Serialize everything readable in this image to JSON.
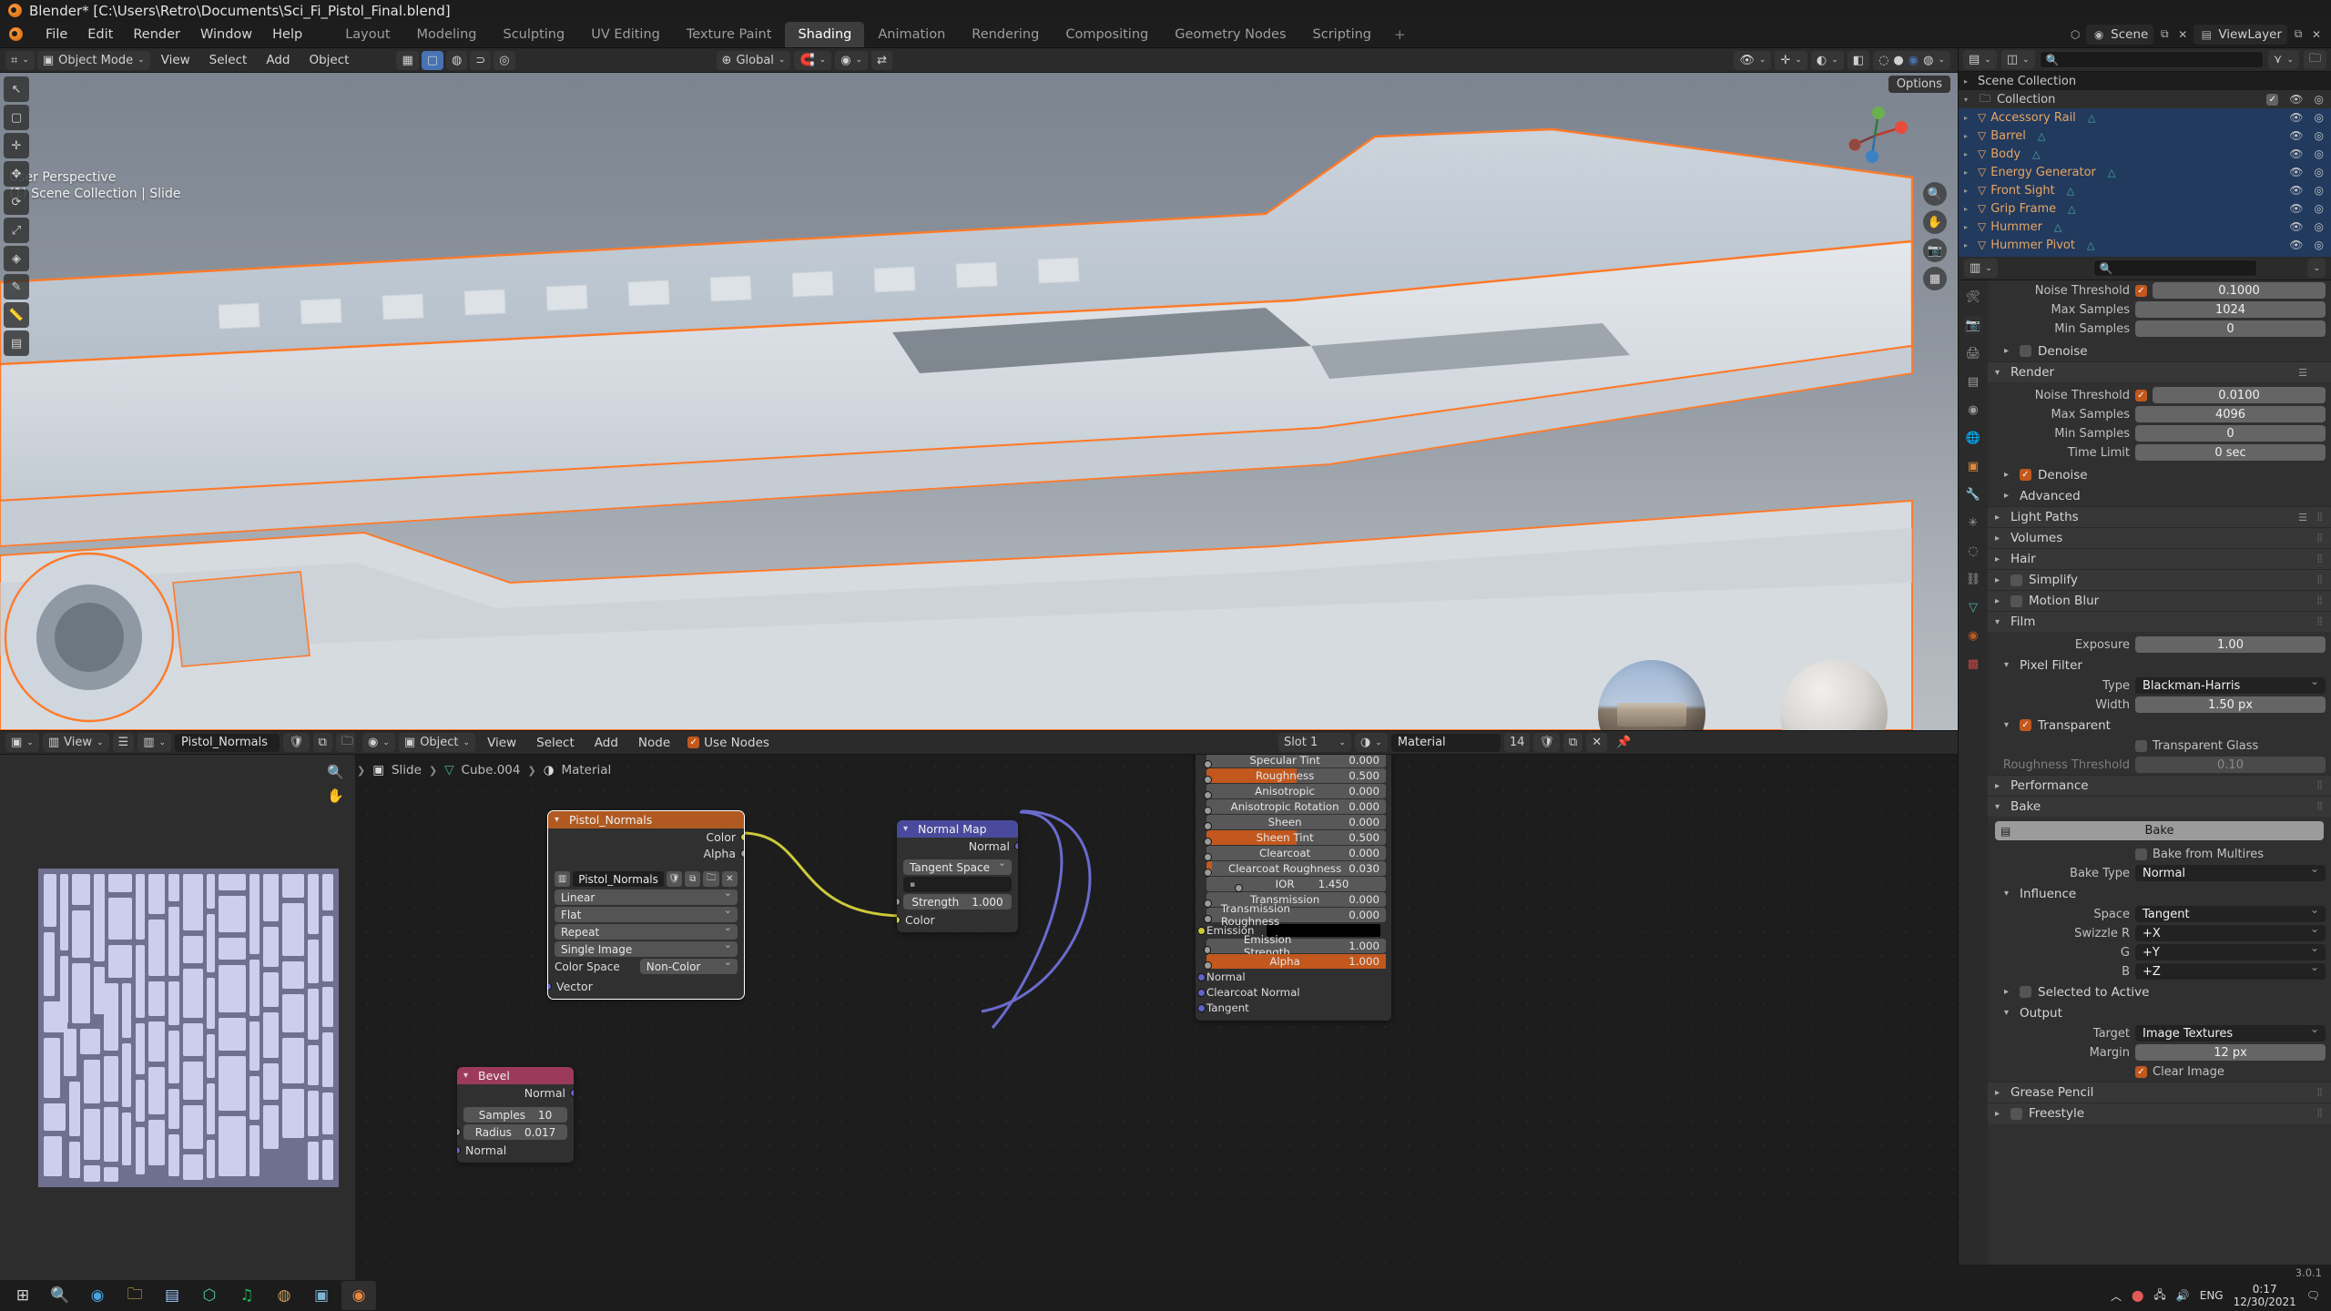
{
  "window": {
    "title": "Blender* [C:\\Users\\Retro\\Documents\\Sci_Fi_Pistol_Final.blend]"
  },
  "topbar": {
    "menus": [
      "File",
      "Edit",
      "Render",
      "Window",
      "Help"
    ],
    "workspace_tabs": [
      {
        "label": "Layout",
        "active": false
      },
      {
        "label": "Modeling",
        "active": false
      },
      {
        "label": "Sculpting",
        "active": false
      },
      {
        "label": "UV Editing",
        "active": false
      },
      {
        "label": "Texture Paint",
        "active": false
      },
      {
        "label": "Shading",
        "active": true
      },
      {
        "label": "Animation",
        "active": false
      },
      {
        "label": "Rendering",
        "active": false
      },
      {
        "label": "Compositing",
        "active": false
      },
      {
        "label": "Geometry Nodes",
        "active": false
      },
      {
        "label": "Scripting",
        "active": false
      }
    ],
    "add_tab": "+",
    "scene_name": "Scene",
    "viewlayer_name": "ViewLayer"
  },
  "viewport": {
    "mode": "Object Mode",
    "menus": [
      "View",
      "Select",
      "Add",
      "Object"
    ],
    "transform_orientation": "Global",
    "options_label": "Options",
    "overlay_line1": "User Perspective",
    "overlay_line2": "(1) Scene Collection | Slide"
  },
  "outliner": {
    "search_placeholder": "",
    "scene_collection": "Scene Collection",
    "collection": "Collection",
    "items": [
      {
        "name": "Accessory Rail"
      },
      {
        "name": "Barrel"
      },
      {
        "name": "Body"
      },
      {
        "name": "Energy Generator"
      },
      {
        "name": "Front Sight"
      },
      {
        "name": "Grip Frame"
      },
      {
        "name": "Hummer"
      },
      {
        "name": "Hummer Pivot"
      }
    ]
  },
  "properties": {
    "sampling_viewport": {
      "noise_threshold_label": "Noise Threshold",
      "noise_threshold_value": "0.1000",
      "max_samples_label": "Max Samples",
      "max_samples_value": "1024",
      "min_samples_label": "Min Samples",
      "min_samples_value": "0",
      "denoise_label": "Denoise"
    },
    "render": {
      "panel_label": "Render",
      "noise_threshold_label": "Noise Threshold",
      "noise_threshold_value": "0.0100",
      "max_samples_label": "Max Samples",
      "max_samples_value": "4096",
      "min_samples_label": "Min Samples",
      "min_samples_value": "0",
      "time_limit_label": "Time Limit",
      "time_limit_value": "0 sec",
      "denoise_label": "Denoise",
      "advanced_label": "Advanced"
    },
    "sections": [
      {
        "label": "Light Paths"
      },
      {
        "label": "Volumes"
      },
      {
        "label": "Hair"
      },
      {
        "label": "Simplify"
      },
      {
        "label": "Motion Blur"
      }
    ],
    "film": {
      "panel_label": "Film",
      "exposure_label": "Exposure",
      "exposure_value": "1.00",
      "pixel_filter_label": "Pixel Filter",
      "type_label": "Type",
      "type_value": "Blackman-Harris",
      "width_label": "Width",
      "width_value": "1.50 px",
      "transparent_label": "Transparent",
      "transparent_glass_label": "Transparent Glass",
      "roughness_threshold_label": "Roughness Threshold",
      "roughness_threshold_value": "0.10"
    },
    "performance_label": "Performance",
    "bake": {
      "panel_label": "Bake",
      "bake_button": "Bake",
      "bake_from_multires_label": "Bake from Multires",
      "bake_type_label": "Bake Type",
      "bake_type_value": "Normal",
      "influence_label": "Influence",
      "space_label": "Space",
      "space_value": "Tangent",
      "swizzle_r_label": "Swizzle R",
      "swizzle_r_value": "+X",
      "swizzle_g_label": "G",
      "swizzle_g_value": "+Y",
      "swizzle_b_label": "B",
      "swizzle_b_value": "+Z",
      "selected_to_active_label": "Selected to Active",
      "output_label": "Output",
      "target_label": "Target",
      "target_value": "Image Textures",
      "margin_label": "Margin",
      "margin_value": "12 px",
      "clear_image_label": "Clear Image"
    },
    "grease_pencil_label": "Grease Pencil",
    "freestyle_label": "Freestyle"
  },
  "image_editor": {
    "view_menu": "View",
    "image_name": "Pistol_Normals"
  },
  "node_editor": {
    "shader_type": "Object",
    "menus": [
      "View",
      "Select",
      "Add",
      "Node"
    ],
    "use_nodes_label": "Use Nodes",
    "slot_label": "Slot 1",
    "material_name": "Material",
    "material_users": "14",
    "breadcrumb": [
      "Slide",
      "Cube.004",
      "Material"
    ],
    "nodes": {
      "image_texture": {
        "title": "Pistol_Normals",
        "outputs": [
          "Color",
          "Alpha"
        ],
        "image_name": "Pistol_Normals",
        "interpolation": "Linear",
        "projection": "Flat",
        "extension": "Repeat",
        "source": "Single Image",
        "color_space_label": "Color Space",
        "color_space_value": "Non-Color",
        "input_vector": "Vector"
      },
      "normal_map": {
        "title": "Normal Map",
        "output": "Normal",
        "space": "Tangent Space",
        "uv_map": "",
        "strength_label": "Strength",
        "strength_value": "1.000",
        "input_color": "Color"
      },
      "bevel": {
        "title": "Bevel",
        "output": "Normal",
        "samples_label": "Samples",
        "samples_value": "10",
        "radius_label": "Radius",
        "radius_value": "0.017",
        "input_normal": "Normal"
      },
      "principled": {
        "rows": [
          {
            "label": "Specular Tint",
            "value": "0.000",
            "fill": 0
          },
          {
            "label": "Roughness",
            "value": "0.500",
            "fill": 50
          },
          {
            "label": "Anisotropic",
            "value": "0.000",
            "fill": 0
          },
          {
            "label": "Anisotropic Rotation",
            "value": "0.000",
            "fill": 0
          },
          {
            "label": "Sheen",
            "value": "0.000",
            "fill": 0
          },
          {
            "label": "Sheen Tint",
            "value": "0.500",
            "fill": 50
          },
          {
            "label": "Clearcoat",
            "value": "0.000",
            "fill": 0
          },
          {
            "label": "Clearcoat Roughness",
            "value": "0.030",
            "fill": 3
          },
          {
            "label": "IOR",
            "value": "1.450",
            "fill": 0
          },
          {
            "label": "Transmission",
            "value": "0.000",
            "fill": 0
          },
          {
            "label": "Transmission Roughness",
            "value": "0.000",
            "fill": 0
          }
        ],
        "emission_label": "Emission",
        "emission_strength_label": "Emission Strength",
        "emission_strength_value": "1.000",
        "alpha_label": "Alpha",
        "alpha_value": "1.000",
        "vector_inputs": [
          "Normal",
          "Clearcoat Normal",
          "Tangent"
        ]
      }
    }
  },
  "taskbar": {
    "language": "ENG",
    "time": "0:17",
    "date": "12/30/2021"
  },
  "statusbar": {
    "version": "3.0.1"
  },
  "colors": {
    "accent_orange": "#c2581e",
    "selection_blue": "#223a5e",
    "node_image_header": "#b05a22",
    "node_normalmap_header": "#4a4a9c",
    "node_bevel_header": "#9c3a5c"
  }
}
